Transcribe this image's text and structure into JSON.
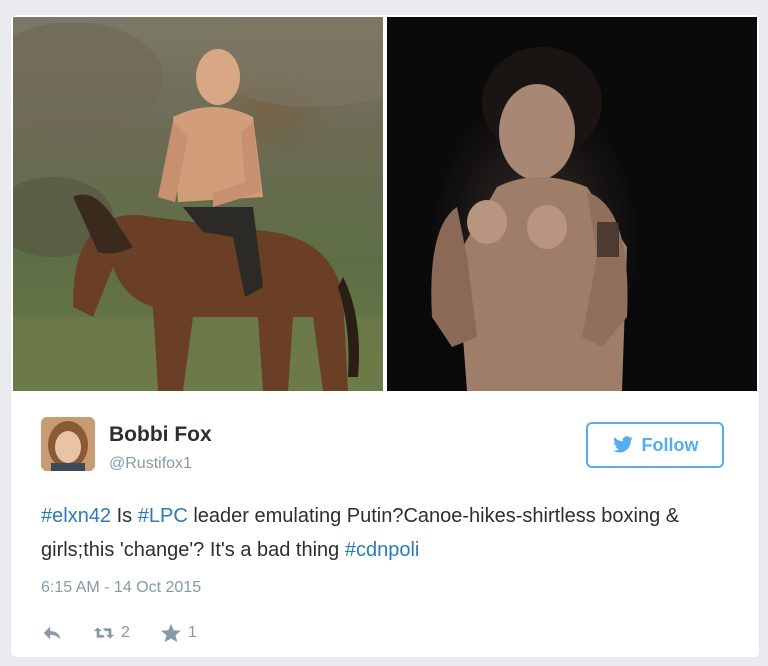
{
  "author": {
    "name": "Bobbi Fox",
    "handle": "@Rustifox1"
  },
  "follow_button": {
    "label": "Follow",
    "icon": "twitter-bird-icon"
  },
  "tweet": {
    "text_parts": [
      {
        "text": "#elxn42",
        "type": "hashtag"
      },
      {
        "text": " Is ",
        "type": "plain"
      },
      {
        "text": "#LPC",
        "type": "hashtag"
      },
      {
        "text": " leader emulating Putin?Canoe-hikes-shirtless boxing & girls;this 'change'? It's a bad thing ",
        "type": "plain"
      },
      {
        "text": "#cdnpoli",
        "type": "hashtag"
      }
    ],
    "timestamp": "6:15 AM - 14 Oct 2015"
  },
  "actions": {
    "reply_icon": "reply-icon",
    "retweet_icon": "retweet-icon",
    "retweet_count": "2",
    "favorite_icon": "star-icon",
    "favorite_count": "1"
  },
  "colors": {
    "link": "#2b7bb9",
    "follow": "#55acee",
    "muted": "#8899a6",
    "text": "#292f33"
  }
}
